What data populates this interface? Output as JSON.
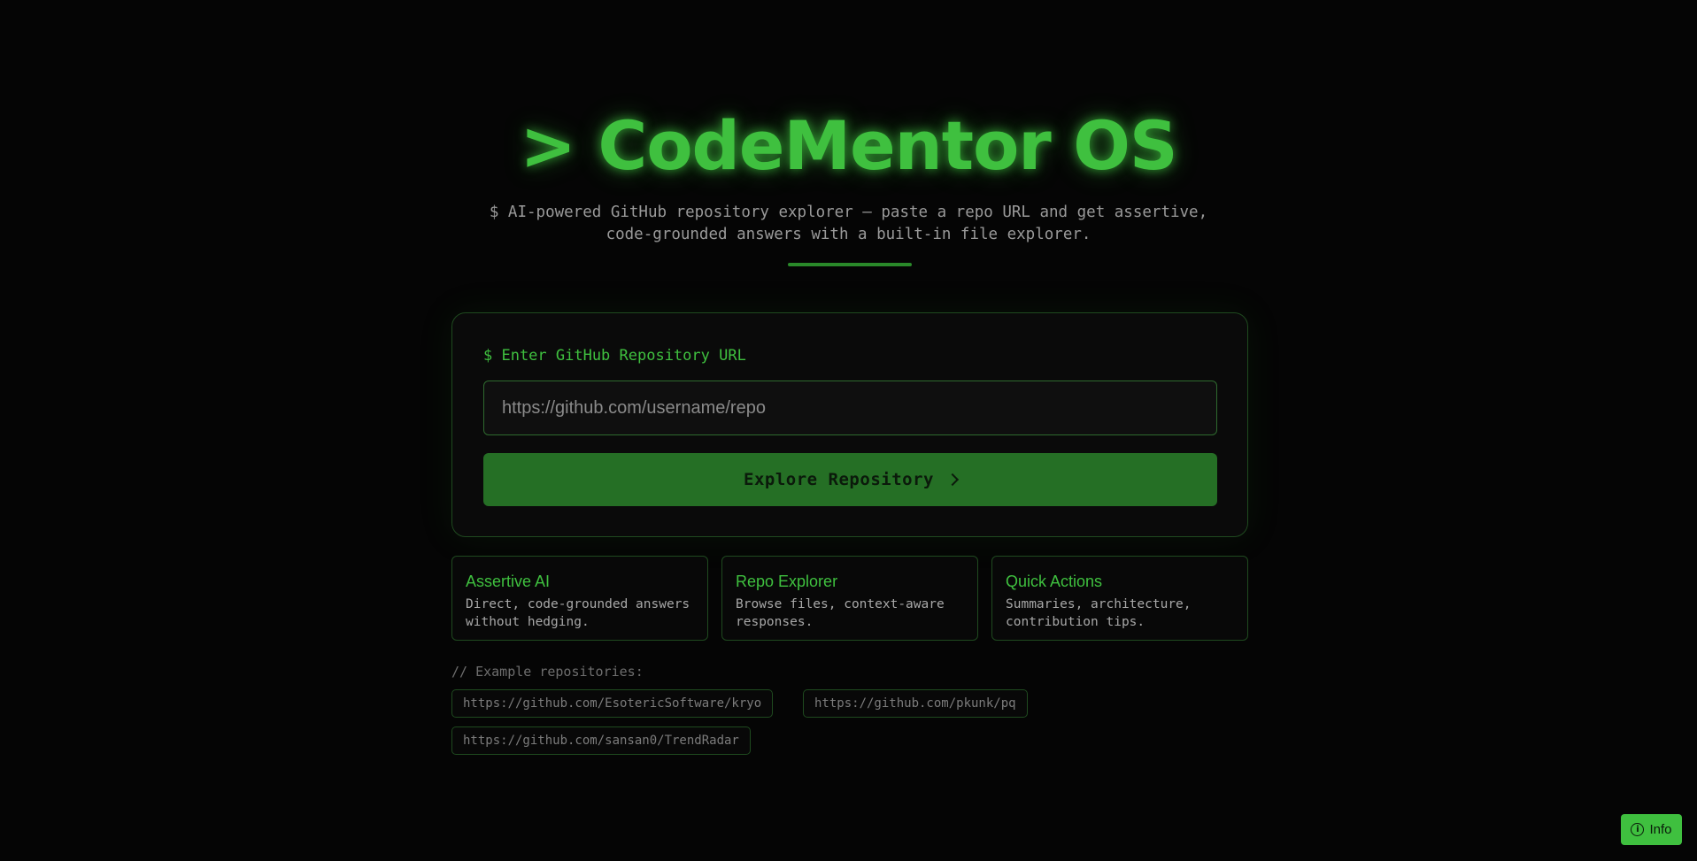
{
  "hero": {
    "title": "> CodeMentor OS",
    "subtitle_line1": "$ AI-powered GitHub repository explorer — paste a repo URL and get assertive,",
    "subtitle_line2": "code-grounded answers with a built-in file explorer."
  },
  "form": {
    "label": "$ Enter GitHub Repository URL",
    "url_value": "",
    "url_placeholder": "https://github.com/username/repo",
    "submit_label": "Explore Repository"
  },
  "features": [
    {
      "title": "Assertive AI",
      "description": "Direct, code-grounded answers without hedging."
    },
    {
      "title": "Repo Explorer",
      "description": "Browse files, context-aware responses."
    },
    {
      "title": "Quick Actions",
      "description": "Summaries, architecture, contribution tips."
    }
  ],
  "examples": {
    "label": "// Example repositories:",
    "items": [
      "https://github.com/EsotericSoftware/kryo",
      "https://github.com/pkunk/pq",
      "https://github.com/sansan0/TrendRadar"
    ]
  },
  "info_button": {
    "label": "Info",
    "icon": "info-circle-icon"
  },
  "colors": {
    "accent": "#3fc03f",
    "button": "#256f25",
    "background": "#050505",
    "border": "#1f4a1f"
  }
}
